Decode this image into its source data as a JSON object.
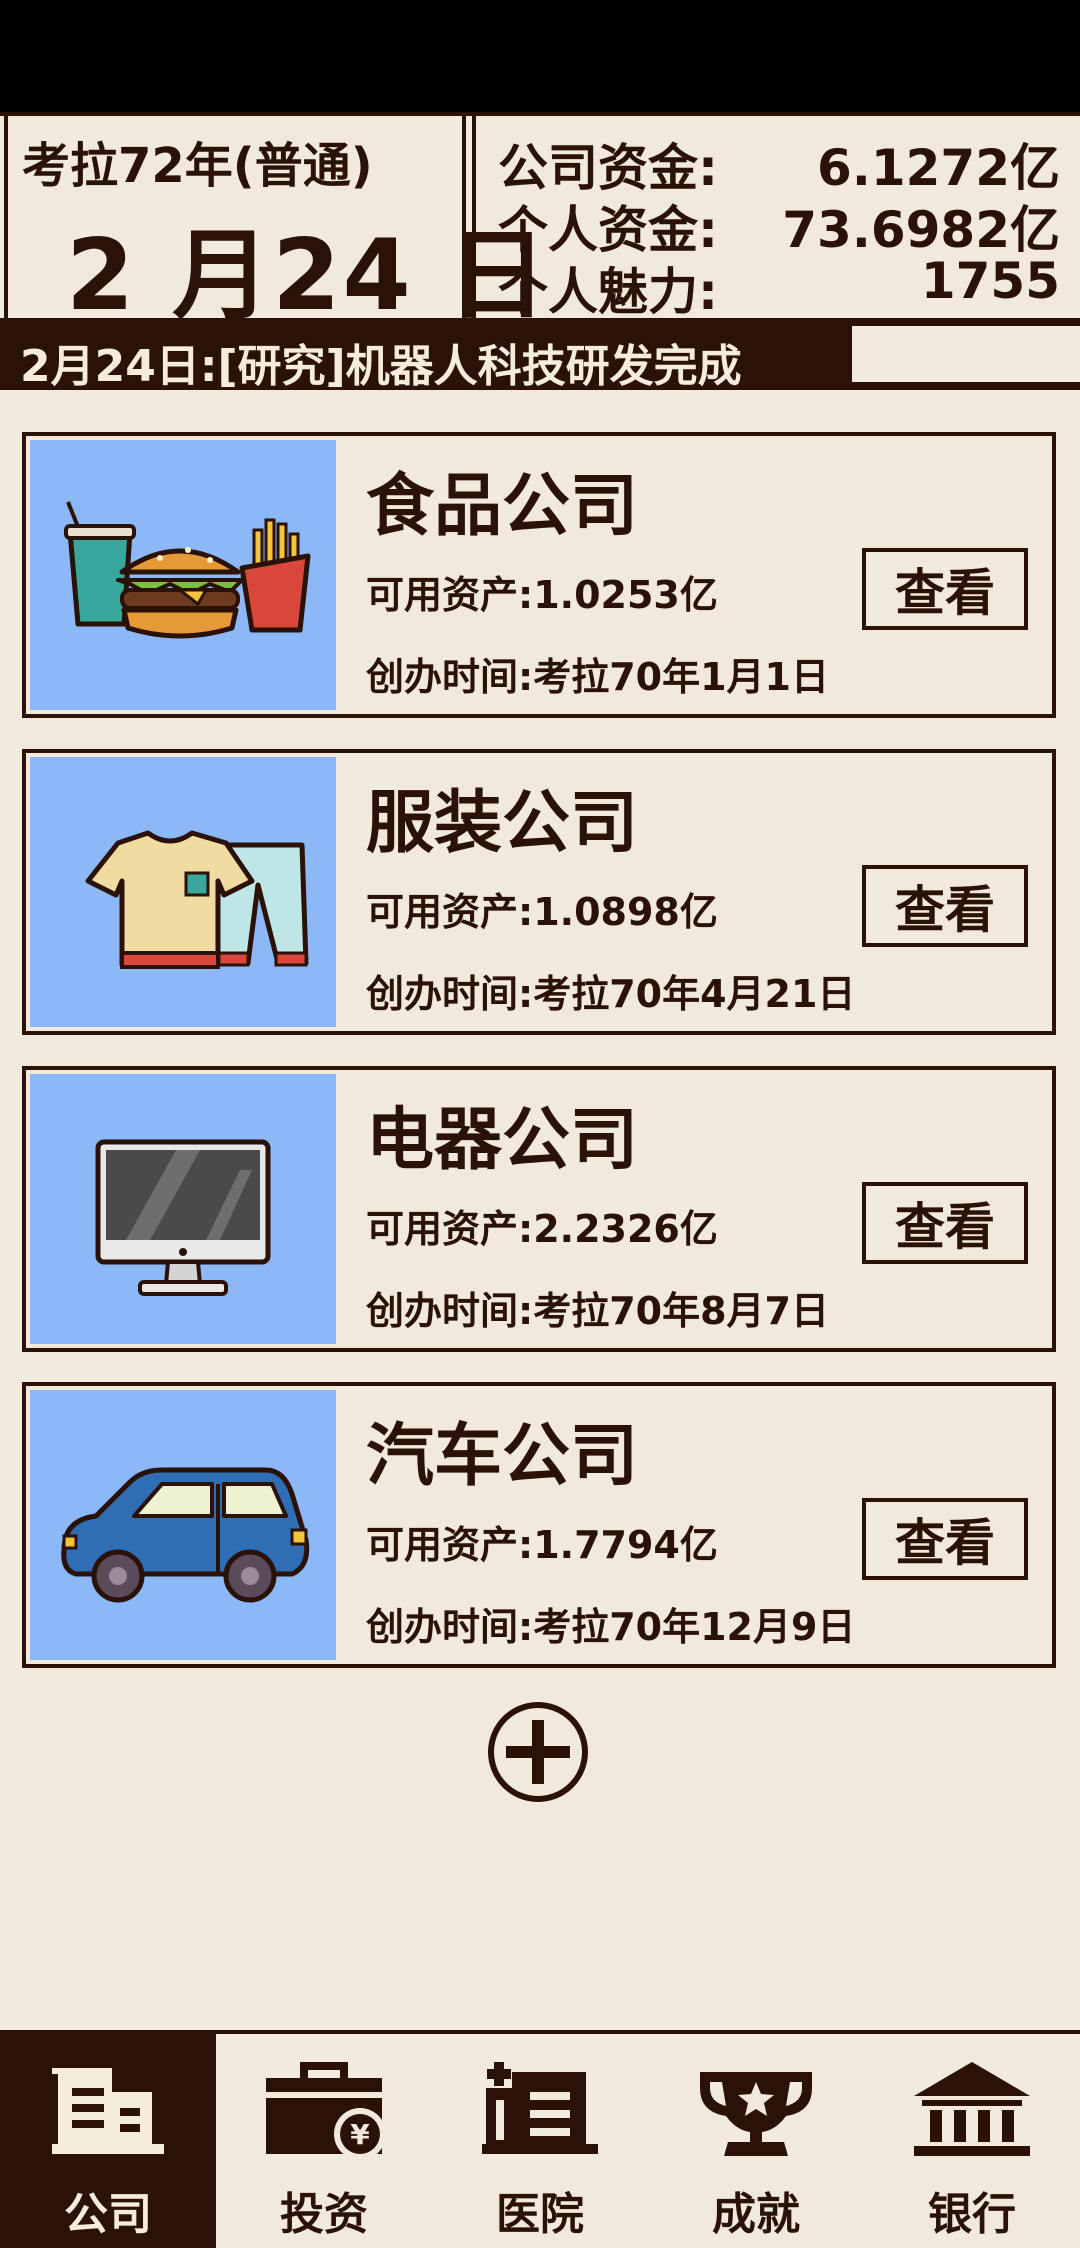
{
  "header": {
    "era": "考拉72年(普通)",
    "date": "2 月24 日",
    "stats": [
      {
        "label": "公司资金:",
        "value": "6.1272亿"
      },
      {
        "label": "个人资金:",
        "value": "73.6982亿"
      },
      {
        "label": "个人魅力:",
        "value": "1755"
      }
    ]
  },
  "news": "2月24日:[研究]机器人科技研发完成",
  "companies": [
    {
      "name": "食品公司",
      "assets": "可用资产:1.0253亿",
      "founded": "创办时间:考拉70年1月1日",
      "button": "查看",
      "icon": "food-icon"
    },
    {
      "name": "服装公司",
      "assets": "可用资产:1.0898亿",
      "founded": "创办时间:考拉70年4月21日",
      "button": "查看",
      "icon": "clothing-icon"
    },
    {
      "name": "电器公司",
      "assets": "可用资产:2.2326亿",
      "founded": "创办时间:考拉70年8月7日",
      "button": "查看",
      "icon": "monitor-icon"
    },
    {
      "name": "汽车公司",
      "assets": "可用资产:1.7794亿",
      "founded": "创办时间:考拉70年12月9日",
      "button": "查看",
      "icon": "car-icon"
    }
  ],
  "nav": [
    {
      "label": "公司",
      "icon": "company-building-icon",
      "active": true
    },
    {
      "label": "投资",
      "icon": "briefcase-yen-icon",
      "active": false
    },
    {
      "label": "医院",
      "icon": "hospital-icon",
      "active": false
    },
    {
      "label": "成就",
      "icon": "trophy-icon",
      "active": false
    },
    {
      "label": "银行",
      "icon": "bank-icon",
      "active": false
    }
  ],
  "colors": {
    "background": "#f1e9dc",
    "dark": "#2a1208",
    "card_image_bg": "#8db8f7"
  }
}
